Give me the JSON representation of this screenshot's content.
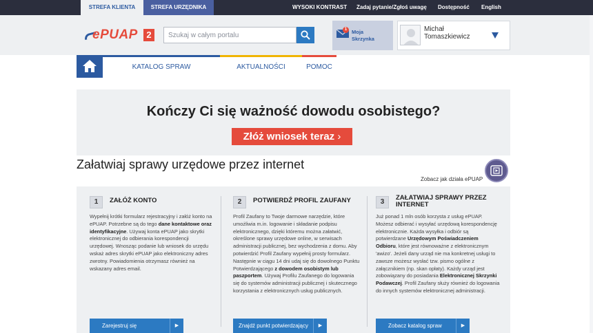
{
  "topbar": {
    "zone_klient": "STREFA KLIENTA",
    "zone_urzednik": "STREFA URZĘDNIKA",
    "links": {
      "kontrast": "WYSOKI KONTRAST",
      "zadaj": "Zadaj pytanie/Zgłoś uwagę",
      "dostepnosc": "Dostępność",
      "english": "English"
    }
  },
  "header": {
    "logo_text": "ePUAP",
    "logo_badge": "2",
    "search_placeholder": "Szukaj w całym portalu",
    "skrzynka_count": "1",
    "skrzynka_label": "Moja Skrzynka",
    "user_name": "Michał Tomaszkiewicz"
  },
  "nav": {
    "katalog": "KATALOG SPRAW",
    "aktualnosci": "AKTUALNOŚCI",
    "pomoc": "POMOC"
  },
  "banner": {
    "title": "Kończy Ci się ważność dowodu osobistego?",
    "button": "Złóż wniosek teraz"
  },
  "section": {
    "title": "Załatwiaj sprawy urzędowe przez internet",
    "howto_link": "Zobacz jak działa ePUAP"
  },
  "steps": [
    {
      "num": "1",
      "title": "ZAŁÓŻ KONTO",
      "text_parts": [
        "Wypełnij krótki formularz rejestracyjny i załóż konto na ePUAP. Potrzebne są do tego ",
        "dane kontaktowe oraz identyfikacyjne",
        ". Używaj konta ePUAP jako skrytki elektronicznej do odbierania korespondencji urzędowej. Wnosząc podanie lub wniosek do urzędu wskaż adres skrytki ePUAP jako elektroniczny adres zwrotny. Powiadomienia otrzymasz również na wskazany adres email."
      ],
      "button": "Zarejestruj się"
    },
    {
      "num": "2",
      "title": "POTWIERDŹ PROFIL ZAUFANY",
      "text_parts": [
        "Profil Zaufany to Twoje darmowe narzędzie, które umożliwia m.in. logowanie i składanie podpisu elektronicznego, dzięki któremu można załatwić, określone sprawy urzędowe online, w serwisach administracji publicznej, bez wychodzenia z domu. Aby potwierdzić Profil Zaufany wypełnij prosty formularz. Następnie w ciągu 14 dni udaj się do dowolnego Punktu Potwierdzającego ",
        "z dowodem osobistym lub paszportem",
        ". Używaj Profilu Zaufanego do logowania się do systemów administracji publicznej i skutecznego korzystania z elektronicznych usług publicznych."
      ],
      "button": "Znajdź punkt potwierdzający"
    },
    {
      "num": "3",
      "title": "ZAŁATWIAJ SPRAWY PRZEZ INTERNET",
      "text_parts": [
        "Już ponad 1 mln osób korzysta z usług ePUAP. Możesz odbierać i wysyłać urzędową korespondencję elektronicznie. Każda wysyłka i odbiór są potwierdzane ",
        "Urzędowym Poświadczeniem Odbioru",
        ", które jest równoważne z elektronicznym 'awizo'. Jeżeli dany urząd nie ma konkretnej usługi to zawsze możesz wysłać tzw. pismo ogólne z załącznikiem (np. skan opłaty). Każdy urząd jest zobowiązany do posiadania ",
        "Elektronicznej Skrzynki Podawczej",
        ". Profil Zaufany służy również do logowania do innych systemów elektronicznej administracji."
      ],
      "button": "Zobacz katalog spraw"
    }
  ]
}
